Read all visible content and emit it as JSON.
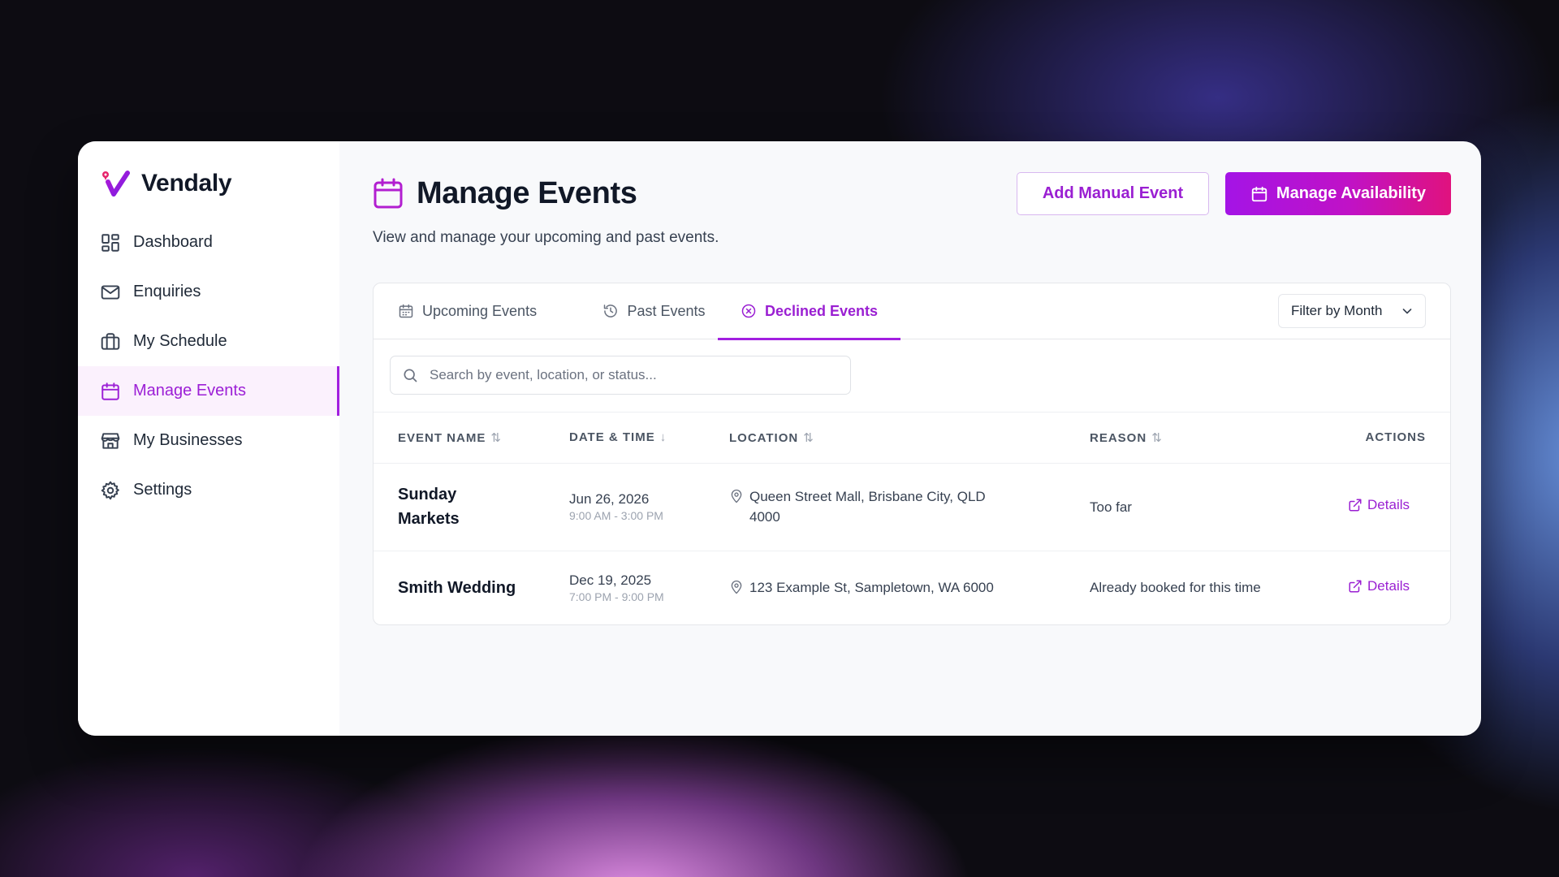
{
  "brand": {
    "name": "Vendaly"
  },
  "sidebar": {
    "items": [
      {
        "label": "Dashboard",
        "icon": "dashboard-icon"
      },
      {
        "label": "Enquiries",
        "icon": "mail-icon"
      },
      {
        "label": "My Schedule",
        "icon": "briefcase-icon"
      },
      {
        "label": "Manage Events",
        "icon": "calendar-icon",
        "active": true
      },
      {
        "label": "My Businesses",
        "icon": "store-icon"
      },
      {
        "label": "Settings",
        "icon": "gear-icon"
      }
    ]
  },
  "header": {
    "title": "Manage Events",
    "subtitle": "View and manage your upcoming and past events.",
    "add_manual_label": "Add Manual Event",
    "manage_availability_label": "Manage Availability"
  },
  "tabs": [
    {
      "label": "Upcoming Events",
      "icon": "calendar-icon"
    },
    {
      "label": "Past Events",
      "icon": "history-icon"
    },
    {
      "label": "Declined Events",
      "icon": "x-circle-icon",
      "active": true
    }
  ],
  "filter": {
    "label": "Filter by Month"
  },
  "search": {
    "placeholder": "Search by event, location, or status..."
  },
  "table": {
    "columns": {
      "name": "EVENT NAME",
      "date": "DATE & TIME",
      "location": "LOCATION",
      "reason": "REASON",
      "actions": "ACTIONS"
    },
    "rows": [
      {
        "name": "Sunday Markets",
        "date": "Jun 26, 2026",
        "time": "9:00 AM - 3:00 PM",
        "location": "Queen Street Mall, Brisbane City, QLD 4000",
        "reason": "Too far",
        "action": "Details"
      },
      {
        "name": "Smith Wedding",
        "date": "Dec 19, 2025",
        "time": "7:00 PM - 9:00 PM",
        "location": "123 Example St, Sampletown, WA 6000",
        "reason": "Already booked for this time",
        "action": "Details"
      }
    ]
  },
  "colors": {
    "accent": "#a21fe0",
    "gradient_start": "#a414e6",
    "gradient_end": "#e0127e"
  }
}
